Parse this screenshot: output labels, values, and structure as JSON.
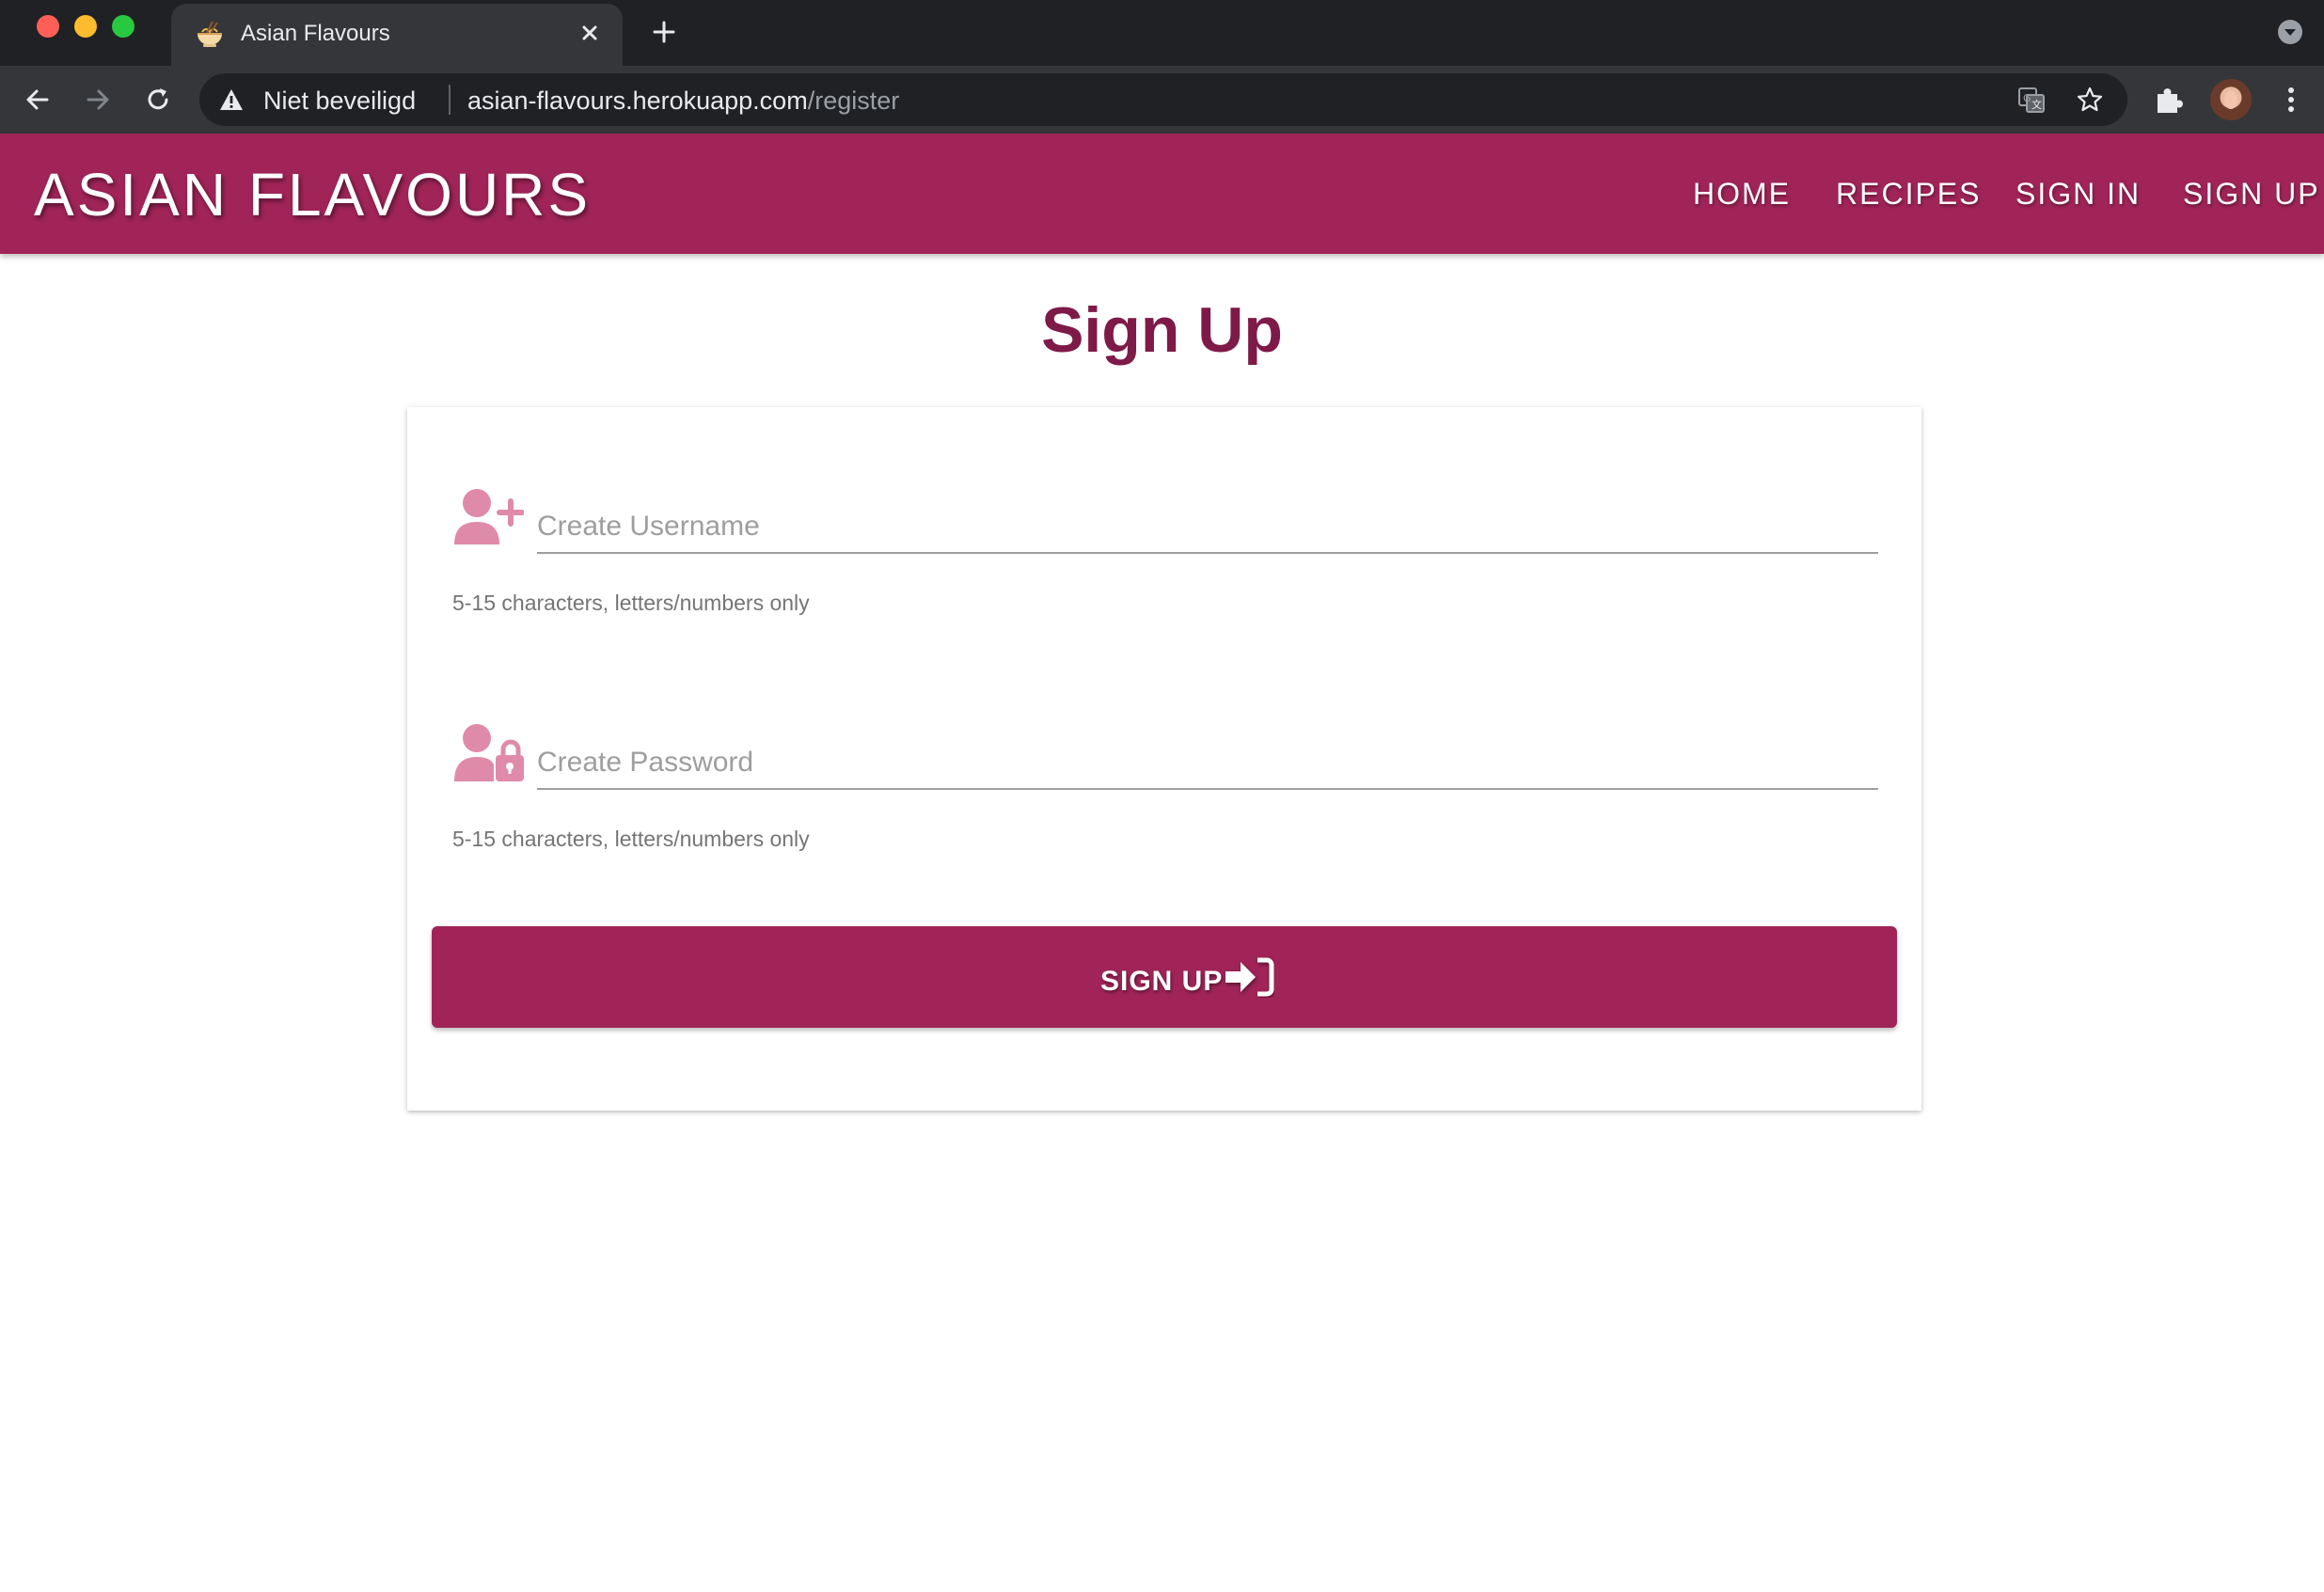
{
  "browser": {
    "tab_title": "Asian Flavours",
    "security_label": "Niet beveiligd",
    "url_host": "asian-flavours.herokuapp.com",
    "url_path": "/register"
  },
  "navbar": {
    "brand": "ASIAN FLAVOURS",
    "links": [
      "HOME",
      "RECIPES",
      "SIGN IN",
      "SIGN UP"
    ],
    "color": "#a02458"
  },
  "page": {
    "title": "Sign Up"
  },
  "form": {
    "username": {
      "placeholder": "Create Username",
      "value": "",
      "helper": "5-15 characters, letters/numbers only",
      "icon": "user-plus-icon"
    },
    "password": {
      "placeholder": "Create Password",
      "value": "",
      "helper": "5-15 characters, letters/numbers only",
      "icon": "user-lock-icon"
    },
    "submit_label": "SIGN UP",
    "submit_icon": "sign-in-icon"
  },
  "colors": {
    "accent": "#a02458",
    "title": "#7e1a48",
    "icon": "#e08aaa"
  }
}
